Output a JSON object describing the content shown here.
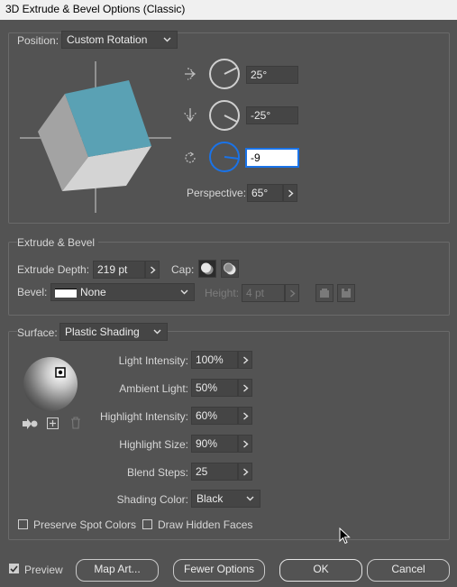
{
  "window": {
    "title": "3D Extrude & Bevel Options (Classic)"
  },
  "position": {
    "label": "Position:",
    "preset": "Custom Rotation",
    "x_rotation": "25°",
    "y_rotation": "-25°",
    "z_rotation": "-9",
    "perspective_label": "Perspective:",
    "perspective_value": "65°"
  },
  "extrude": {
    "section_title": "Extrude & Bevel",
    "depth_label": "Extrude Depth:",
    "depth_value": "219 pt",
    "cap_label": "Cap:",
    "bevel_label": "Bevel:",
    "bevel_value": "None",
    "height_label": "Height:",
    "height_value": "4 pt"
  },
  "surface": {
    "label": "Surface:",
    "value": "Plastic Shading",
    "light_intensity_label": "Light Intensity:",
    "light_intensity_value": "100%",
    "ambient_light_label": "Ambient Light:",
    "ambient_light_value": "50%",
    "highlight_intensity_label": "Highlight Intensity:",
    "highlight_intensity_value": "60%",
    "highlight_size_label": "Highlight Size:",
    "highlight_size_value": "90%",
    "blend_steps_label": "Blend Steps:",
    "blend_steps_value": "25",
    "shading_color_label": "Shading Color:",
    "shading_color_value": "Black",
    "preserve_spot_label": "Preserve Spot Colors",
    "draw_hidden_label": "Draw Hidden Faces"
  },
  "footer": {
    "preview_label": "Preview",
    "preview_checked": true,
    "map_art_label": "Map Art...",
    "fewer_options_label": "Fewer Options",
    "ok_label": "OK",
    "cancel_label": "Cancel"
  },
  "colors": {
    "background": "#535353",
    "cube_front": "#5aa1b4",
    "cube_side": "#9a9a9a",
    "cube_bottom": "#d2d2d2",
    "accent": "#1a73e8"
  },
  "icons": [
    "x-axis-rotate-icon",
    "y-axis-rotate-icon",
    "z-axis-rotate-icon",
    "cap-on-icon",
    "cap-off-icon",
    "bevel-out-icon",
    "bevel-in-icon",
    "move-light-back-icon",
    "new-light-icon",
    "delete-light-icon",
    "chevron-right-icon",
    "chevron-down-icon",
    "checkmark-icon",
    "mouse-cursor-icon"
  ]
}
